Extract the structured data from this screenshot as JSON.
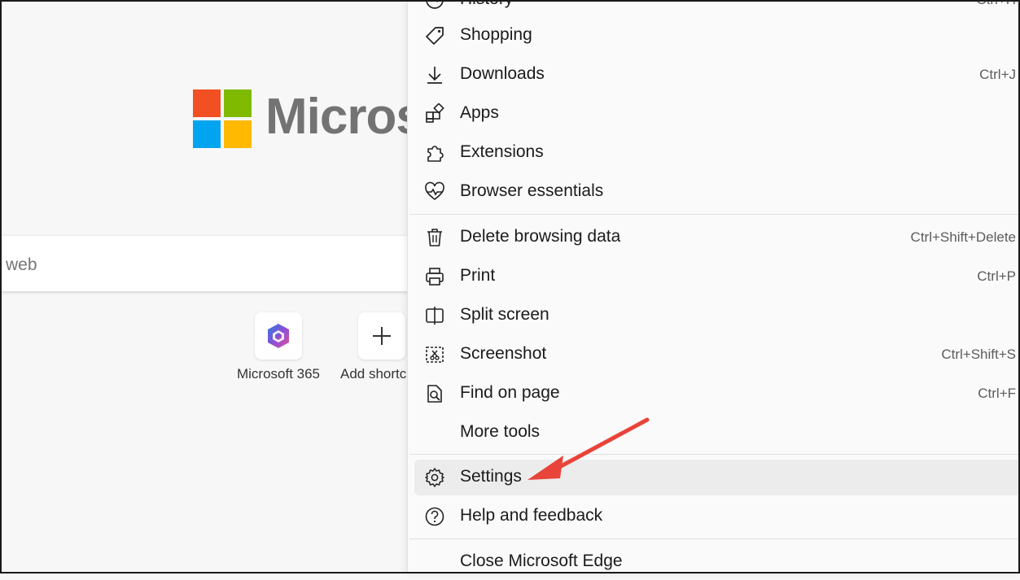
{
  "ntp": {
    "wordmark": "Micros",
    "search_placeholder": "web",
    "shortcuts": [
      {
        "label": "Microsoft 365"
      },
      {
        "label": "Add shortc"
      }
    ]
  },
  "menu": {
    "top_item": {
      "label": "History",
      "shortcut": "Ctrl+H"
    },
    "items": [
      {
        "label": "Shopping",
        "shortcut": ""
      },
      {
        "label": "Downloads",
        "shortcut": "Ctrl+J"
      },
      {
        "label": "Apps",
        "shortcut": ""
      },
      {
        "label": "Extensions",
        "shortcut": ""
      },
      {
        "label": "Browser essentials",
        "shortcut": ""
      },
      {
        "label": "Delete browsing data",
        "shortcut": "Ctrl+Shift+Delete"
      },
      {
        "label": "Print",
        "shortcut": "Ctrl+P"
      },
      {
        "label": "Split screen",
        "shortcut": ""
      },
      {
        "label": "Screenshot",
        "shortcut": "Ctrl+Shift+S"
      },
      {
        "label": "Find on page",
        "shortcut": "Ctrl+F"
      },
      {
        "label": "More tools",
        "shortcut": ""
      },
      {
        "label": "Settings",
        "shortcut": ""
      },
      {
        "label": "Help and feedback",
        "shortcut": ""
      },
      {
        "label": "Close Microsoft Edge",
        "shortcut": ""
      }
    ]
  },
  "colors": {
    "ms_red": "#f25022",
    "ms_green": "#7fba00",
    "ms_blue": "#00a4ef",
    "ms_yellow": "#ffb900",
    "annotation_arrow": "#e8443a"
  }
}
